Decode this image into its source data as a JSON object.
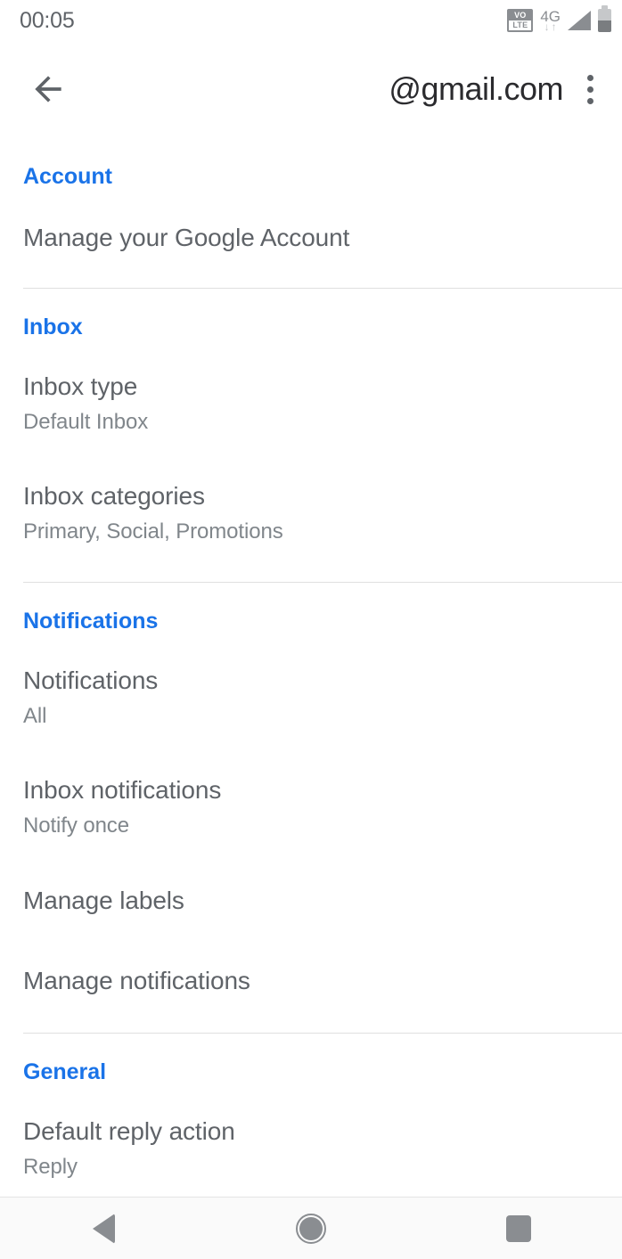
{
  "status_bar": {
    "time": "00:05",
    "volte_top": "VO",
    "volte_bottom": "LTE",
    "network": "4G",
    "arrow_down": "↓",
    "arrow_up": "↑",
    "icons": [
      "volte-icon",
      "network-4g-icon",
      "signal-icon",
      "battery-icon"
    ]
  },
  "app_bar": {
    "back_icon": "back-arrow-icon",
    "title": "@gmail.com",
    "overflow_icon": "overflow-menu-icon"
  },
  "colors": {
    "accent_blue": "#1a73e8",
    "primary_text": "#5f6368",
    "secondary_text": "#80868b",
    "title_text": "#2b2b2e",
    "divider": "#e0e0e0",
    "background": "#ffffff",
    "navbar_background": "#fafafa",
    "navbar_icon": "#8a8d91"
  },
  "sections": [
    {
      "header": "Account",
      "rows": [
        {
          "title": "Manage your Google Account",
          "subtitle": ""
        }
      ]
    },
    {
      "header": "Inbox",
      "rows": [
        {
          "title": "Inbox type",
          "subtitle": "Default Inbox"
        },
        {
          "title": "Inbox categories",
          "subtitle": "Primary, Social, Promotions"
        }
      ]
    },
    {
      "header": "Notifications",
      "rows": [
        {
          "title": "Notifications",
          "subtitle": "All"
        },
        {
          "title": "Inbox notifications",
          "subtitle": "Notify once"
        },
        {
          "title": "Manage labels",
          "subtitle": ""
        },
        {
          "title": "Manage notifications",
          "subtitle": ""
        }
      ]
    },
    {
      "header": "General",
      "rows": [
        {
          "title": "Default reply action",
          "subtitle": "Reply"
        }
      ]
    }
  ],
  "nav_bar": {
    "back_label": "Back",
    "home_label": "Home",
    "recents_label": "Recent apps",
    "icons": [
      "nav-back-icon",
      "nav-home-icon",
      "nav-recents-icon"
    ]
  }
}
